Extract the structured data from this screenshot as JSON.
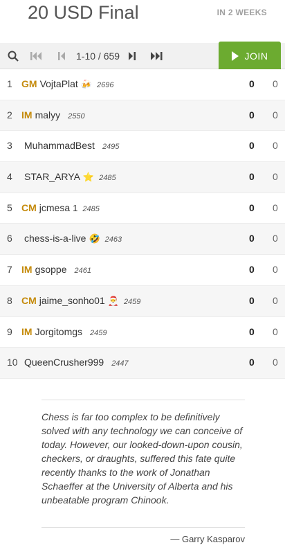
{
  "header": {
    "title": "20 USD Final",
    "starts": "IN 2 WEEKS"
  },
  "pager": {
    "count": "1-10 / 659",
    "join_label": "JOIN",
    "icons": [
      "search-icon",
      "first-page-icon",
      "prev-page-icon",
      "next-page-icon",
      "last-page-icon"
    ]
  },
  "standings": [
    {
      "rank": "1",
      "title": "GM",
      "name": "VojtaPlat",
      "emoji": "🍻",
      "rating": "2696",
      "score": "0",
      "score2": "0"
    },
    {
      "rank": "2",
      "title": "IM",
      "name": "malyy",
      "emoji": "",
      "rating": "2550",
      "score": "0",
      "score2": "0"
    },
    {
      "rank": "3",
      "title": "",
      "name": "MuhammadBest",
      "emoji": "",
      "rating": "2495",
      "score": "0",
      "score2": "0"
    },
    {
      "rank": "4",
      "title": "",
      "name": "STAR_ARYA",
      "emoji": "⭐",
      "rating": "2485",
      "score": "0",
      "score2": "0"
    },
    {
      "rank": "5",
      "title": "CM",
      "name": "jcmesa",
      "emoji": "1",
      "rating": "2485",
      "score": "0",
      "score2": "0"
    },
    {
      "rank": "6",
      "title": "",
      "name": "chess-is-a-live",
      "emoji": "🤣",
      "rating": "2463",
      "score": "0",
      "score2": "0"
    },
    {
      "rank": "7",
      "title": "IM",
      "name": "gsoppe",
      "emoji": "",
      "rating": "2461",
      "score": "0",
      "score2": "0"
    },
    {
      "rank": "8",
      "title": "CM",
      "name": "jaime_sonho01",
      "emoji": "🎅",
      "rating": "2459",
      "score": "0",
      "score2": "0"
    },
    {
      "rank": "9",
      "title": "IM",
      "name": "Jorgitomgs",
      "emoji": "",
      "rating": "2459",
      "score": "0",
      "score2": "0"
    },
    {
      "rank": "10",
      "title": "",
      "name": "QueenCrusher999",
      "emoji": "",
      "rating": "2447",
      "score": "0",
      "score2": "0"
    }
  ],
  "quote": {
    "text": "Chess is far too complex to be definitively solved with any technology we can conceive of today. However, our looked-down-upon cousin, checkers, or draughts, suffered this fate quite recently thanks to the work of Jonathan Schaeffer at the University of Alberta and his unbeatable program Chinook.",
    "author": "— Garry Kasparov"
  },
  "colors": {
    "accent": "#6cab30",
    "title_badge": "#c58b0c"
  }
}
